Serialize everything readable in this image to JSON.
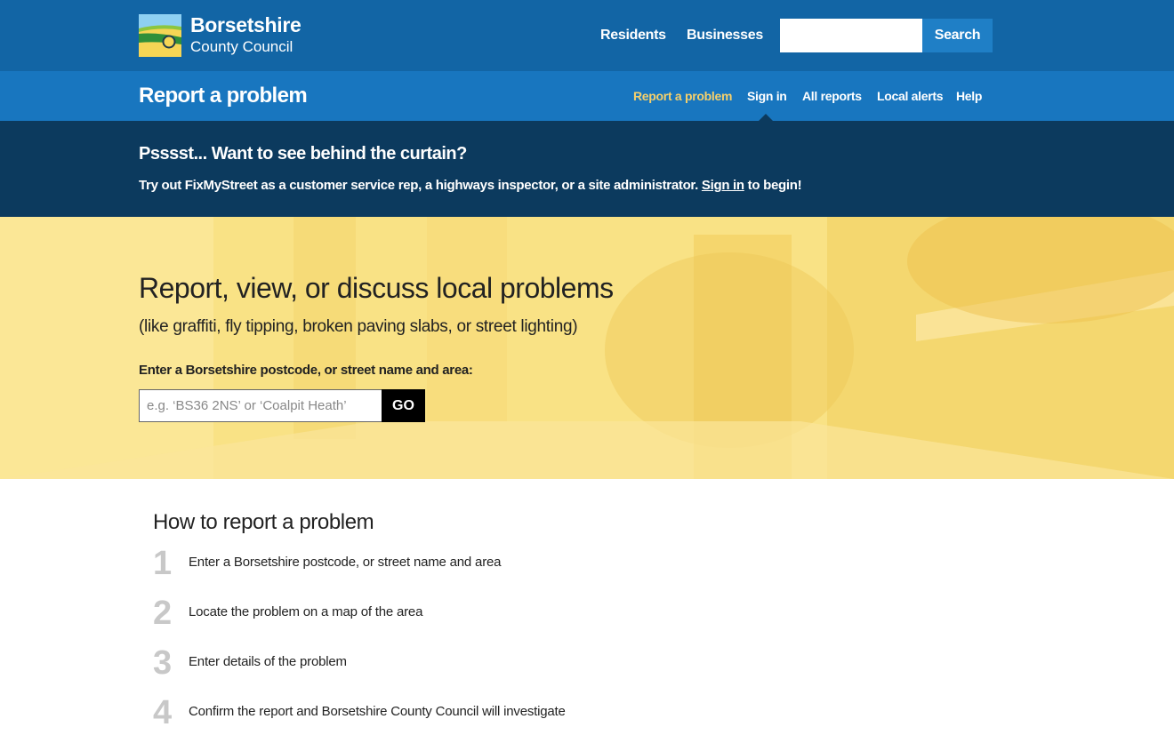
{
  "header": {
    "logo": {
      "line1": "Borsetshire",
      "line2": "County Council"
    },
    "links": [
      "Residents",
      "Businesses"
    ],
    "search": {
      "placeholder": "",
      "value": "",
      "button": "Search"
    }
  },
  "subnav": {
    "title": "Report a problem",
    "items": [
      {
        "label": "Report a problem",
        "active": true
      },
      {
        "label": "Sign in",
        "active": false
      },
      {
        "label": "All reports",
        "active": false
      },
      {
        "label": "Local alerts",
        "active": false
      },
      {
        "label": "Help",
        "active": false
      }
    ]
  },
  "demo": {
    "title": "Psssst... Want to see behind the curtain?",
    "text_before": "Try out FixMyStreet as a customer service rep, a highways inspector, or a site administrator. ",
    "link": "Sign in",
    "text_after": " to begin!"
  },
  "hero": {
    "heading": "Report, view, or discuss local problems",
    "subheading": "(like graffiti, fly tipping, broken paving slabs, or street lighting)",
    "label": "Enter a Borsetshire postcode, or street name and area:",
    "input_placeholder": "e.g. ‘BS36 2NS’ or ‘Coalpit Heath’",
    "input_value": "",
    "button": "GO"
  },
  "howto": {
    "title": "How to report a problem",
    "steps": [
      {
        "num": "1",
        "text": "Enter a Borsetshire postcode, or street name and area"
      },
      {
        "num": "2",
        "text": "Locate the problem on a map of the area"
      },
      {
        "num": "3",
        "text": "Enter details of the problem"
      },
      {
        "num": "4",
        "text": "Confirm the report and Borsetshire County Council will investigate"
      }
    ]
  },
  "colors": {
    "topbar": "#1265a5",
    "subnav": "#1876bf",
    "demo_banner": "#0c3a5e",
    "active_nav": "#f5d06c",
    "hero_yellow": "#f7dc74"
  }
}
